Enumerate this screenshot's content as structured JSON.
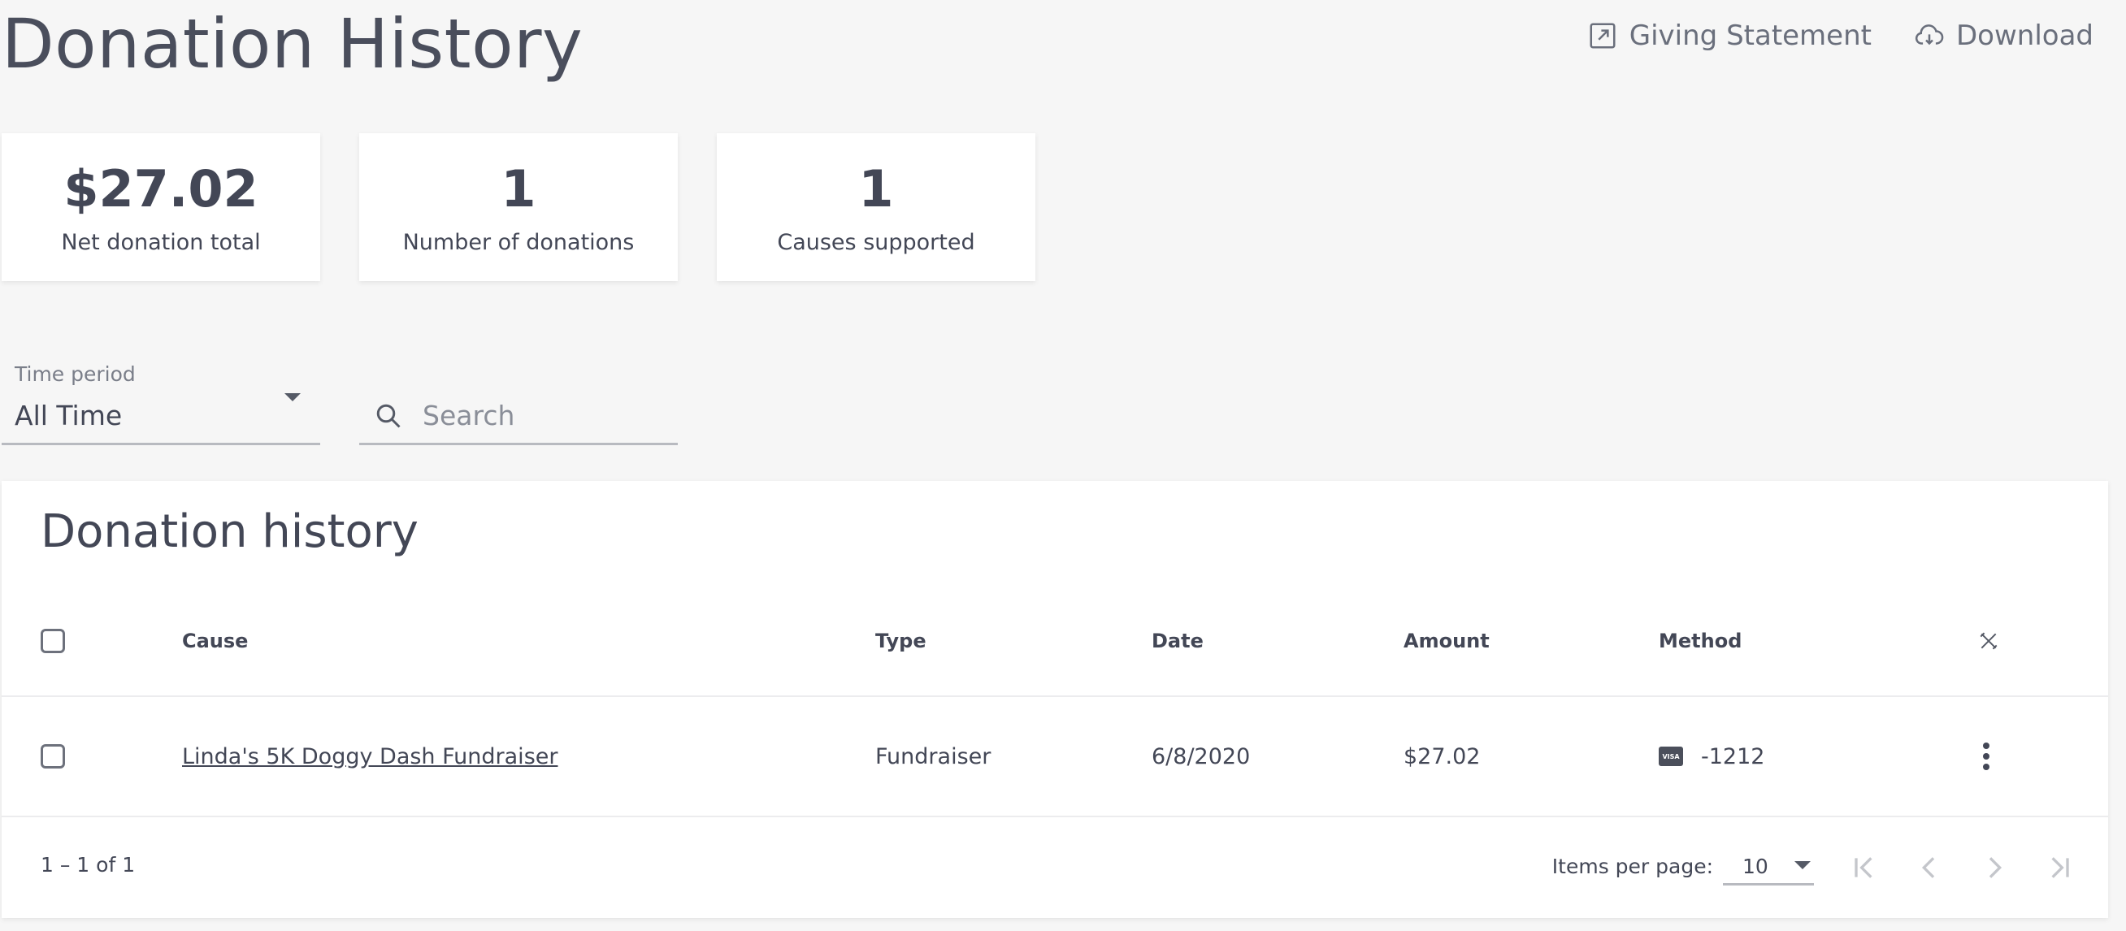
{
  "page": {
    "title": "Donation History"
  },
  "header_actions": {
    "giving_statement": "Giving Statement",
    "download": "Download"
  },
  "stats": [
    {
      "value": "$27.02",
      "label": "Net donation total"
    },
    {
      "value": "1",
      "label": "Number of donations"
    },
    {
      "value": "1",
      "label": "Causes supported"
    }
  ],
  "filters": {
    "time_period_label": "Time period",
    "time_period_value": "All Time",
    "search_placeholder": "Search"
  },
  "table": {
    "title": "Donation history",
    "columns": {
      "cause": "Cause",
      "type": "Type",
      "date": "Date",
      "amount": "Amount",
      "method": "Method"
    },
    "rows": [
      {
        "cause": "Linda's 5K Doggy Dash Fundraiser",
        "type": "Fundraiser",
        "date": "6/8/2020",
        "amount": "$27.02",
        "method_card": "VISA",
        "method_number": "-1212"
      }
    ]
  },
  "pagination": {
    "range": "1 – 1 of 1",
    "items_per_page_label": "Items per page:",
    "items_per_page_value": "10"
  },
  "icons": {
    "giving_statement": "external-link-icon",
    "download": "cloud-download-icon",
    "search": "search-icon",
    "column_settings": "tools-icon",
    "row_menu": "more-vertical-icon"
  },
  "colors": {
    "background": "#f6f6f6",
    "text": "#434756",
    "muted": "#6a6f7c",
    "card": "#ffffff"
  }
}
